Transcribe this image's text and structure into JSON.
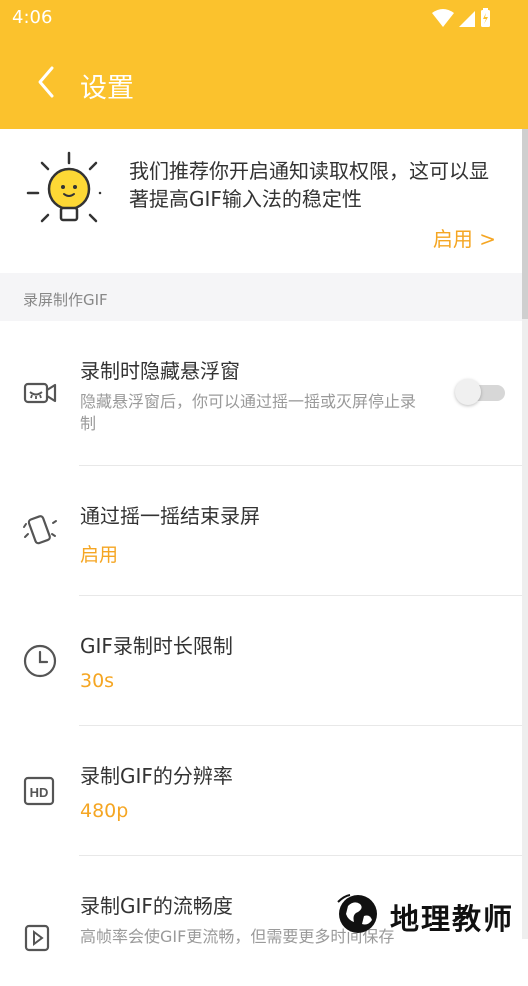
{
  "status_bar": {
    "time": "4:06"
  },
  "app_bar": {
    "title": "设置"
  },
  "promo": {
    "text": "我们推荐你开启通知读取权限，这可以显著提高GIF输入法的稳定性",
    "action": "启用 >"
  },
  "section": {
    "title": "录屏制作GIF"
  },
  "settings": [
    {
      "title": "录制时隐藏悬浮窗",
      "subtitle": "隐藏悬浮窗后，你可以通过摇一摇或灭屏停止录制",
      "toggle_on": false,
      "icon": "camera-hidden-icon"
    },
    {
      "title": "通过摇一摇结束录屏",
      "value": "启用",
      "icon": "shake-phone-icon"
    },
    {
      "title": "GIF录制时长限制",
      "value": "30s",
      "icon": "clock-icon"
    },
    {
      "title": "录制GIF的分辨率",
      "value": "480p",
      "icon": "hd-icon"
    },
    {
      "title": "录制GIF的流畅度",
      "subtitle": "高帧率会使GIF更流畅，但需要更多时间保存",
      "icon": "video-icon"
    }
  ],
  "watermark": {
    "text": "地理教师"
  },
  "colors": {
    "brand": "#FBC22D",
    "accent": "#F5A623"
  }
}
